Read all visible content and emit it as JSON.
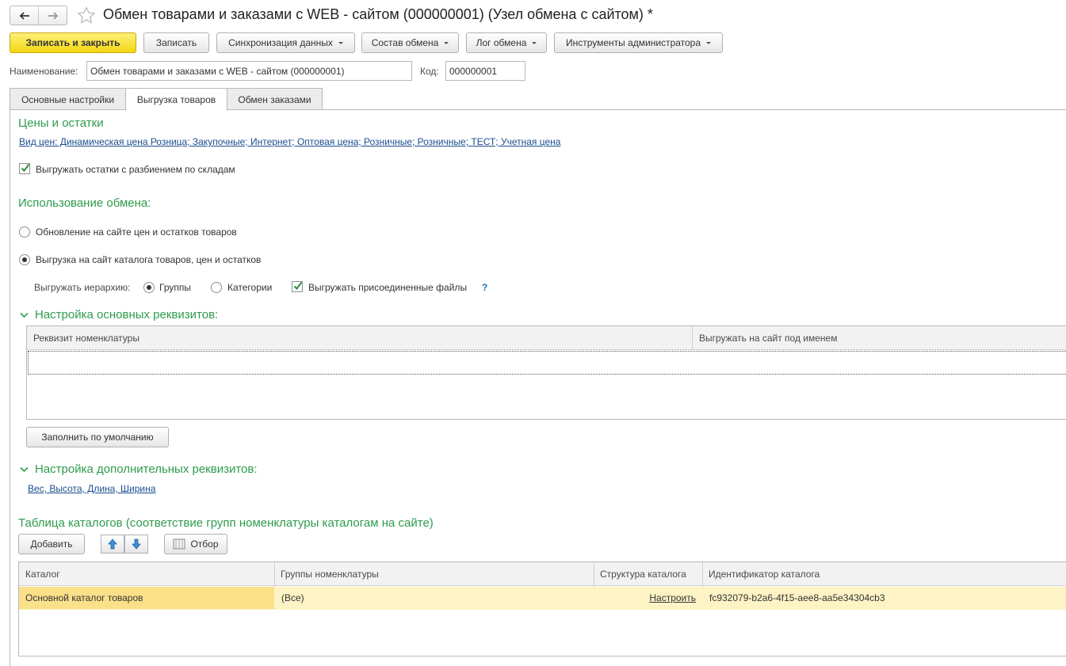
{
  "window": {
    "title": "Обмен товарами и заказами с WEB - сайтом (000000001) (Узел обмена с сайтом) *"
  },
  "toolbar": {
    "save_close": "Записать и закрыть",
    "save": "Записать",
    "sync": "Синхронизация данных",
    "composition": "Состав обмена",
    "log": "Лог обмена",
    "admin_tools": "Инструменты администратора"
  },
  "form": {
    "name_label": "Наименование:",
    "name_value": "Обмен товарами и заказами с WEB - сайтом (000000001)",
    "code_label": "Код:",
    "code_value": "000000001"
  },
  "tabs": [
    {
      "label": "Основные настройки",
      "active": false
    },
    {
      "label": "Выгрузка товаров",
      "active": true
    },
    {
      "label": "Обмен заказами",
      "active": false
    }
  ],
  "prices": {
    "heading": "Цены и остатки",
    "price_types_link": "Вид цен: Динамическая цена Розница; Закупочные; Интернет; Оптовая цена; Розничные; Розничные; ТЕСТ; Учетная цена",
    "split_by_warehouse_label": "Выгружать остатки с разбиением по складам",
    "split_by_warehouse_checked": true
  },
  "usage": {
    "heading": "Использование обмена:",
    "option_update": "Обновление на сайте цен и остатков товаров",
    "option_catalog": "Выгрузка на сайт каталога товаров, цен и остатков",
    "selected": "catalog",
    "hierarchy_label": "Выгружать иерархию:",
    "hierarchy_groups": "Группы",
    "hierarchy_categories": "Категории",
    "hierarchy_selected": "groups",
    "attached_files_label": "Выгружать присоединенные файлы",
    "attached_files_checked": true,
    "help": "?"
  },
  "main_attrs": {
    "heading": "Настройка основных реквизитов:",
    "columns": [
      "Реквизит номенклатуры",
      "Выгружать на сайт под именем"
    ],
    "fill_default": "Заполнить по умолчанию"
  },
  "extra_attrs": {
    "heading": "Настройка дополнительных реквизитов:",
    "link": "Вес, Высота, Длина, Ширина"
  },
  "catalogs": {
    "heading": "Таблица каталогов (соответствие групп номенклатуры каталогам на сайте)",
    "add_button": "Добавить",
    "filter_button": "Отбор",
    "columns": [
      "Каталог",
      "Группы номенклатуры",
      "Структура каталога",
      "Идентификатор каталога"
    ],
    "rows": [
      {
        "catalog": "Основной каталог товаров",
        "groups": "(Все)",
        "structure": "Настроить",
        "id": "fc932079-b2a6-4f15-aee8-aa5e34304cb3"
      }
    ]
  },
  "colors": {
    "accent_green": "#2e9b4d",
    "primary_yellow": "#f3d610",
    "link_blue": "#1a4d8f",
    "row_highlight": "#fdf3c5"
  }
}
